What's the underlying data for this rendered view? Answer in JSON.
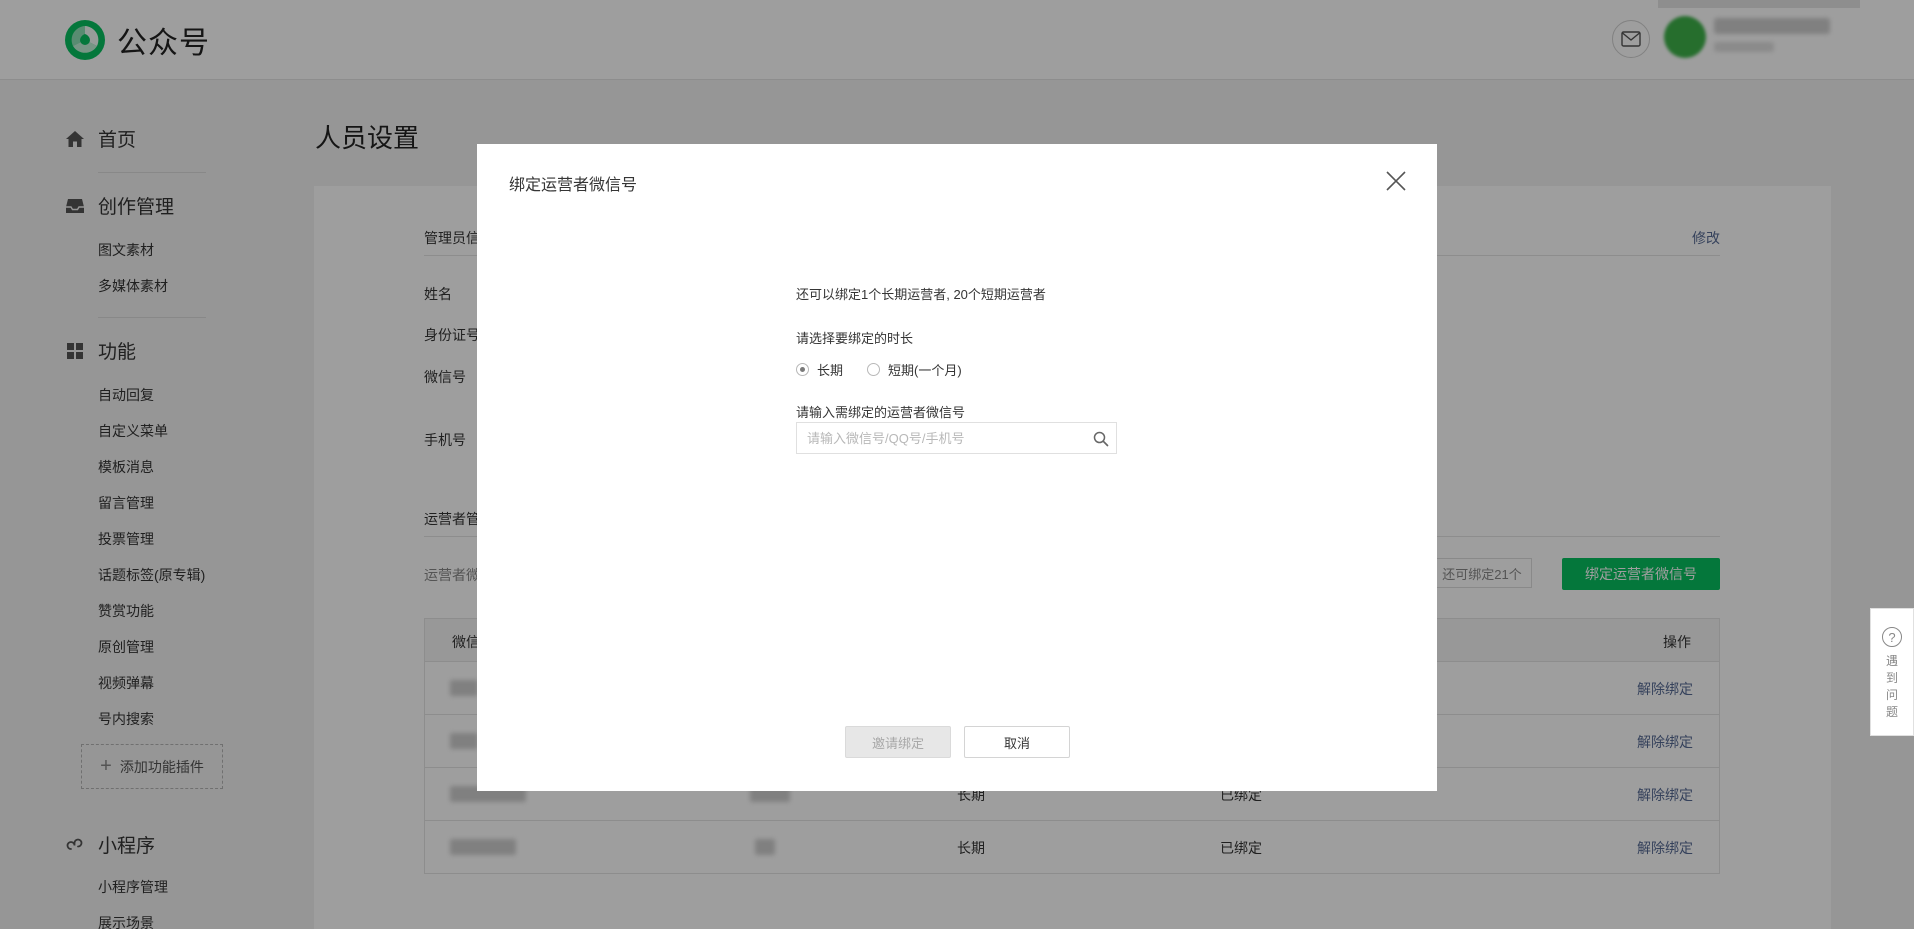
{
  "header": {
    "logo_text": "公众号"
  },
  "sidebar": {
    "home": "首页",
    "creation": {
      "title": "创作管理",
      "items": [
        "图文素材",
        "多媒体素材"
      ]
    },
    "features": {
      "title": "功能",
      "items": [
        "自动回复",
        "自定义菜单",
        "模板消息",
        "留言管理",
        "投票管理",
        "话题标签(原专辑)",
        "赞赏功能",
        "原创管理",
        "视频弹幕",
        "号内搜索"
      ]
    },
    "add_plugin": "添加功能插件",
    "miniprogram": {
      "title": "小程序",
      "items": [
        "小程序管理",
        "展示场景"
      ]
    }
  },
  "page": {
    "title": "人员设置",
    "admin_section": "管理员信",
    "modify": "修改",
    "fields": {
      "name": "姓名",
      "id_no": "身份证号",
      "wechat": "微信号",
      "phone": "手机号"
    },
    "operator_section": "运营者管",
    "operator_desc": "运营者微",
    "remaining": "还可绑定21个",
    "bind_button": "绑定运营者微信号",
    "table": {
      "headers": [
        "微信",
        "操作"
      ],
      "rows": [
        {
          "duration": "",
          "status": "",
          "action": "解除绑定"
        },
        {
          "duration": "",
          "status": "",
          "action": "解除绑定"
        },
        {
          "duration": "长期",
          "status": "已绑定",
          "action": "解除绑定"
        },
        {
          "duration": "长期",
          "status": "已绑定",
          "action": "解除绑定"
        }
      ]
    }
  },
  "help": {
    "text": "遇到问题"
  },
  "modal": {
    "title": "绑定运营者微信号",
    "quota_text": "还可以绑定1个长期运营者, 20个短期运营者",
    "duration_label": "请选择要绑定的时长",
    "options": [
      {
        "label": "长期",
        "selected": true
      },
      {
        "label": "短期(一个月)",
        "selected": false
      }
    ],
    "input_label": "请输入需绑定的运营者微信号",
    "input_placeholder": "请输入微信号/QQ号/手机号",
    "input_value": "",
    "invite_button": "邀请绑定",
    "cancel_button": "取消"
  },
  "colors": {
    "primary_green": "#07c160",
    "link_blue": "#576b95",
    "overlay": "rgba(0,0,0,0.38)"
  }
}
